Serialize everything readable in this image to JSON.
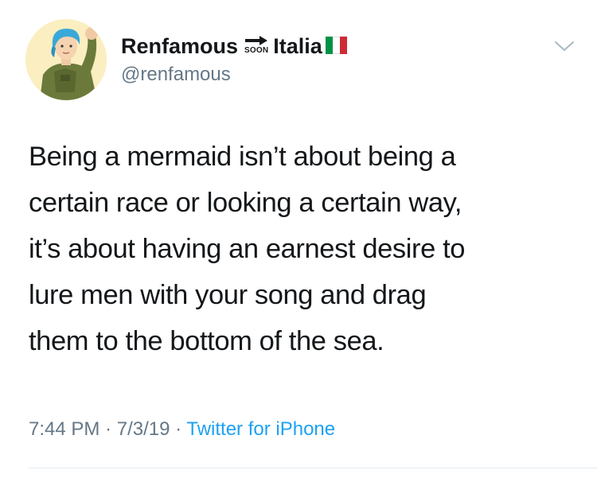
{
  "tweet": {
    "display_name": "Renfamous",
    "soon_emoji_text": "SOON",
    "name_suffix": "Italia",
    "handle": "@renfamous",
    "text": "Being a mermaid isn’t about being a\ncertain race or looking a certain way,\nit’s about having an earnest desire to\nlure men with your song and drag\nthem to the bottom of the sea.",
    "time": "7:44 PM",
    "separator": " · ",
    "date": "7/3/19",
    "source": "Twitter for iPhone"
  },
  "icons": {
    "avatar": "avatar-illustration",
    "soon_arrow": "soon-arrow-icon",
    "flag": "italy-flag-icon",
    "menu": "chevron-down-icon"
  },
  "colors": {
    "text": "#14171a",
    "secondary": "#657786",
    "link": "#1da1f2",
    "flag_green": "#009246",
    "flag_white": "#ffffff",
    "flag_red": "#ce2b37"
  }
}
